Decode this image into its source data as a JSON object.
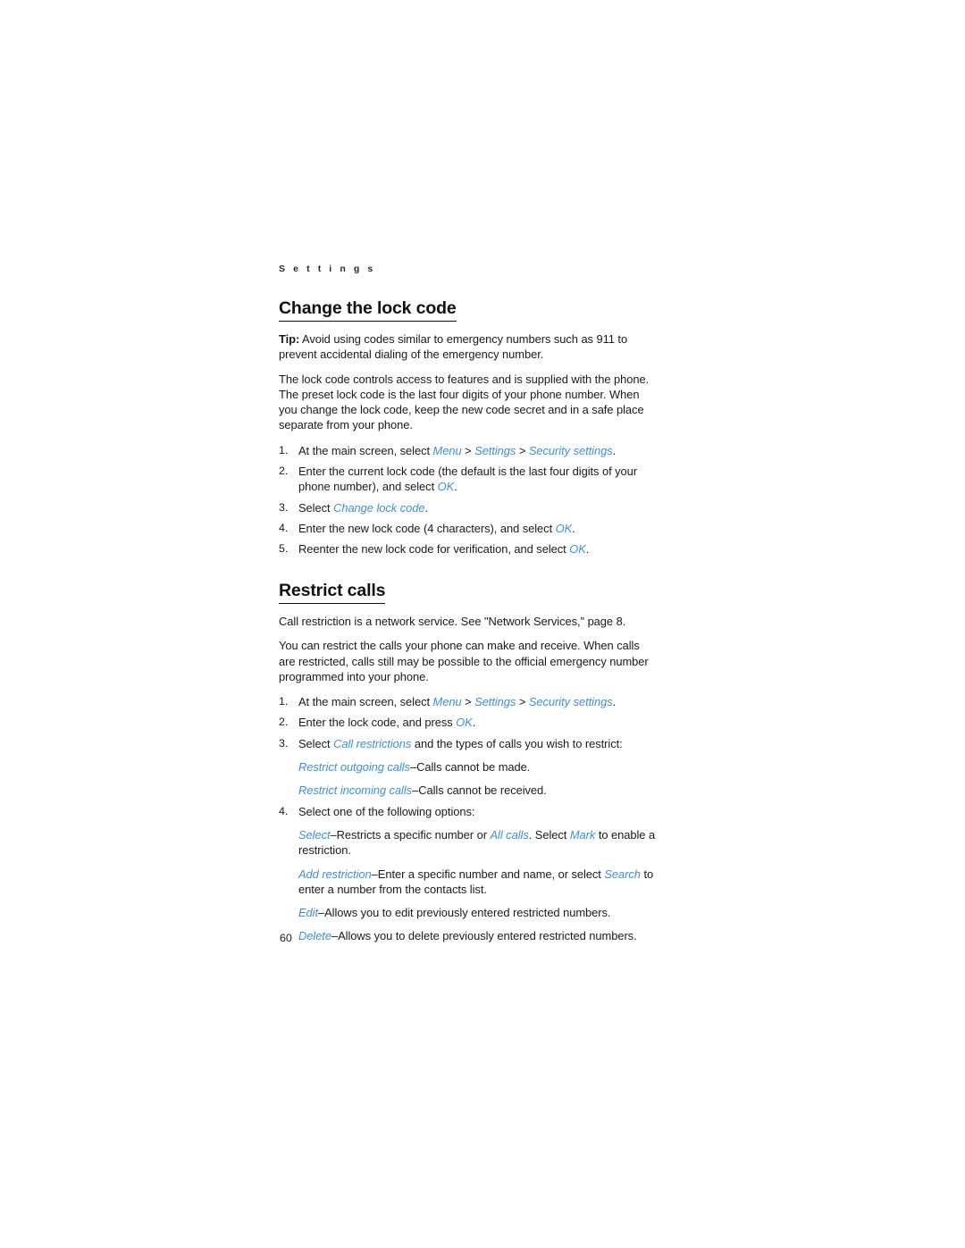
{
  "document": {
    "running_header": "S e t t i n g s",
    "page_number": "60",
    "link_color": "#3d8fdd",
    "text_color": "#1a1a1a"
  },
  "sections": [
    {
      "heading": "Change the lock code",
      "tip_label": "Tip:",
      "tip_text": " Avoid using codes similar to emergency numbers such as 911 to prevent accidental dialing of the emergency number.",
      "body": "The lock code controls access to features and is supplied with the phone. The preset lock code is the last four digits of your phone number. When you change the lock code, keep the new code secret and in a safe place separate from your phone.",
      "steps": [
        {
          "num": "1.",
          "parts": [
            {
              "t": "At the main screen, select ",
              "link": false
            },
            {
              "t": "Menu",
              "link": true
            },
            {
              "t": " > ",
              "link": false
            },
            {
              "t": "Settings",
              "link": true
            },
            {
              "t": " > ",
              "link": false
            },
            {
              "t": "Security settings",
              "link": true
            },
            {
              "t": ".",
              "link": false
            }
          ]
        },
        {
          "num": "2.",
          "parts": [
            {
              "t": "Enter the current lock code (the default is the last four digits of your phone number), and select ",
              "link": false
            },
            {
              "t": "OK",
              "link": true
            },
            {
              "t": ".",
              "link": false
            }
          ]
        },
        {
          "num": "3.",
          "parts": [
            {
              "t": "Select ",
              "link": false
            },
            {
              "t": "Change lock code",
              "link": true
            },
            {
              "t": ".",
              "link": false
            }
          ]
        },
        {
          "num": "4.",
          "parts": [
            {
              "t": "Enter the new lock code (4 characters), and select ",
              "link": false
            },
            {
              "t": "OK",
              "link": true
            },
            {
              "t": ".",
              "link": false
            }
          ]
        },
        {
          "num": "5.",
          "parts": [
            {
              "t": "Reenter the new lock code for verification, and select ",
              "link": false
            },
            {
              "t": "OK",
              "link": true
            },
            {
              "t": ".",
              "link": false
            }
          ]
        }
      ]
    },
    {
      "heading": "Restrict calls",
      "intro": "Call restriction is a network service. See \"Network Services,\" page 8.",
      "body": "You can restrict the calls your phone can make and receive. When calls are restricted, calls still may be possible to the official emergency number programmed into your phone.",
      "steps": [
        {
          "num": "1.",
          "parts": [
            {
              "t": "At the main screen, select ",
              "link": false
            },
            {
              "t": "Menu",
              "link": true
            },
            {
              "t": " > ",
              "link": false
            },
            {
              "t": "Settings",
              "link": true
            },
            {
              "t": " > ",
              "link": false
            },
            {
              "t": "Security settings",
              "link": true
            },
            {
              "t": ".",
              "link": false
            }
          ]
        },
        {
          "num": "2.",
          "parts": [
            {
              "t": "Enter the lock code, and press ",
              "link": false
            },
            {
              "t": "OK",
              "link": true
            },
            {
              "t": ".",
              "link": false
            }
          ]
        },
        {
          "num": "3.",
          "parts": [
            {
              "t": "Select ",
              "link": false
            },
            {
              "t": "Call restrictions",
              "link": true
            },
            {
              "t": " and the types of calls you wish to restrict:",
              "link": false
            }
          ],
          "sublines": [
            [
              {
                "t": "Restrict outgoing calls",
                "link": true
              },
              {
                "t": "–Calls cannot be made.",
                "link": false
              }
            ],
            [
              {
                "t": "Restrict incoming calls",
                "link": true
              },
              {
                "t": "–Calls cannot be received.",
                "link": false
              }
            ]
          ]
        },
        {
          "num": "4.",
          "parts": [
            {
              "t": "Select one of the following options:",
              "link": false
            }
          ],
          "sublines": [
            [
              {
                "t": "Select",
                "link": true
              },
              {
                "t": "–Restricts a specific number or ",
                "link": false
              },
              {
                "t": "All calls",
                "link": true
              },
              {
                "t": ". Select ",
                "link": false
              },
              {
                "t": "Mark",
                "link": true
              },
              {
                "t": " to enable a restriction.",
                "link": false
              }
            ],
            [
              {
                "t": "Add restriction",
                "link": true
              },
              {
                "t": "–Enter a specific number and name, or select ",
                "link": false
              },
              {
                "t": "Search",
                "link": true
              },
              {
                "t": " to enter a number from the contacts list.",
                "link": false
              }
            ],
            [
              {
                "t": "Edit",
                "link": true
              },
              {
                "t": "–Allows you to edit previously entered restricted numbers.",
                "link": false
              }
            ],
            [
              {
                "t": "Delete",
                "link": true
              },
              {
                "t": "–Allows you to delete previously entered restricted numbers.",
                "link": false
              }
            ]
          ]
        }
      ]
    }
  ]
}
